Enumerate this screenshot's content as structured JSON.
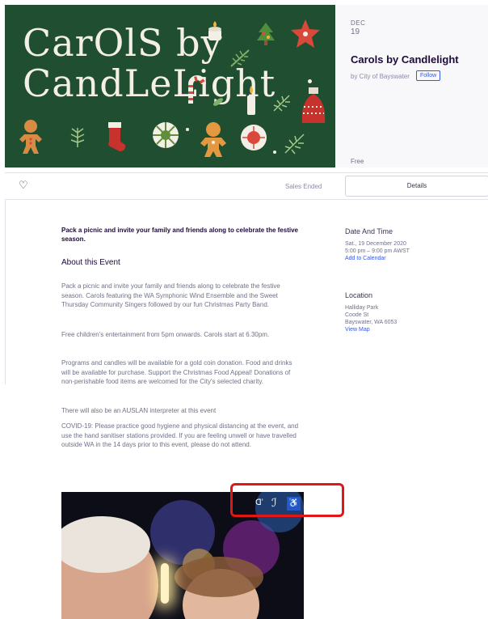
{
  "banner": {
    "title_line1": "CarOlS by",
    "title_line2": "CandLeLight",
    "decorations": [
      "candle-icon",
      "tree-icon",
      "star-icon",
      "branch-icon",
      "candy-cane-icon",
      "leaf-icon",
      "candle-icon",
      "sprig-icon",
      "bauble-icon",
      "gingerbread-icon",
      "leaf-icon",
      "stocking-icon",
      "snowflake-icon",
      "gingerbread-icon",
      "ornament-icon",
      "sprig-icon"
    ],
    "background_color": "#1f4f30"
  },
  "event": {
    "month": "DEC",
    "day": "19",
    "title": "Carols by Candlelight",
    "organizer": "by City of Bayswater",
    "follow_label": "Follow",
    "price": "Free"
  },
  "action_bar": {
    "heart_icon": "♡",
    "sales_status": "Sales Ended",
    "details_label": "Details"
  },
  "description": {
    "summary": "Pack a picnic and invite your family and friends along to celebrate the festive season.",
    "about_heading": "About this Event",
    "paragraphs": [
      "Pack a picnic and invite your family and friends along to celebrate the festive season. Carols featuring the WA Symphonic Wind Ensemble and the Sweet Thursday Community Singers followed by our fun Christmas Party Band.",
      "Free children's entertainment from 5pm onwards. Carols start at 6.30pm.",
      "Programs and candles will be available for a gold coin donation. Food and drinks will be available for purchase. Support the Christmas Food Appeal! Donations of non-perishable food items are welcomed for the City's selected charity.",
      "There will also be an AUSLAN interpreter at this event",
      "COVID-19: Please practice good hygiene and physical distancing at the event, and use the hand sanitiser stations provided. If you are feeling unwell or have travelled outside WA in the 14 days prior to this event, please do not attend."
    ]
  },
  "date_time": {
    "heading": "Date And Time",
    "date": "Sat., 19 December 2020",
    "time": "5:00 pm – 9:00 pm AWST",
    "add_to_calendar": "Add to Calendar"
  },
  "location": {
    "heading": "Location",
    "venue": "Halliday Park",
    "street": "Coode St",
    "suburb": "Bayswater, WA 6053",
    "view_map": "View Map"
  },
  "photo": {
    "accessibility_icons": [
      "hearing-loop-icon",
      "assistive-listening-icon",
      "wheelchair-icon"
    ],
    "wheelchair_glyph": "♿",
    "hearing_glyph": "ᗡʼ",
    "listening_glyph": "ℐ"
  },
  "colors": {
    "accent": "#3659e3",
    "highlight": "#e11717",
    "text_dark": "#1e0a3c",
    "text_muted": "#6f7287"
  }
}
